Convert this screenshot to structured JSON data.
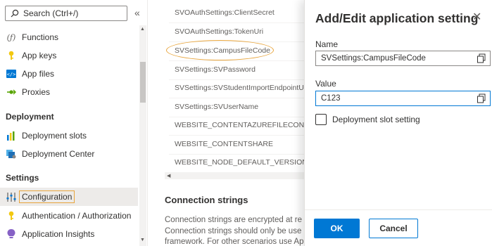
{
  "sidebar": {
    "search_placeholder": "Search (Ctrl+/)",
    "collapse_glyph": "«",
    "items": [
      {
        "label": "Functions",
        "icon": "function-icon"
      },
      {
        "label": "App keys",
        "icon": "key-icon"
      },
      {
        "label": "App files",
        "icon": "code-icon"
      },
      {
        "label": "Proxies",
        "icon": "proxy-icon"
      }
    ],
    "sections": {
      "deployment": "Deployment",
      "settings": "Settings"
    },
    "deployment_items": [
      {
        "label": "Deployment slots",
        "icon": "slots-icon"
      },
      {
        "label": "Deployment Center",
        "icon": "deployment-center-icon"
      }
    ],
    "settings_items": [
      {
        "label": "Configuration",
        "icon": "sliders-icon"
      },
      {
        "label": "Authentication / Authorization",
        "icon": "key-icon"
      },
      {
        "label": "Application Insights",
        "icon": "insights-icon"
      }
    ]
  },
  "settings_list": [
    "SVOAuthSettings:ClientSecret",
    "SVOAuthSettings:TokenUri",
    "SVSettings:CampusFileCode",
    "SVSettings:SVPassword",
    "SVSettings:SVStudentImportEndpointUrl",
    "SVSettings:SVUserName",
    "WEBSITE_CONTENTAZUREFILECONNECTIO",
    "WEBSITE_CONTENTSHARE",
    "WEBSITE_NODE_DEFAULT_VERSION"
  ],
  "connection_strings": {
    "title": "Connection strings",
    "lines": [
      "Connection strings are encrypted at re",
      "Connection strings should only be use",
      "framework. For other scenarios use Ap"
    ]
  },
  "panel": {
    "title": "Add/Edit application setting",
    "name_label": "Name",
    "name_value": "SVSettings:CampusFileCode",
    "value_label": "Value",
    "value_value": "C123",
    "slot_setting_label": "Deployment slot setting",
    "slot_setting_checked": false,
    "ok_label": "OK",
    "cancel_label": "Cancel"
  },
  "colors": {
    "accent": "#0078d4",
    "highlight": "#e8a53c"
  }
}
